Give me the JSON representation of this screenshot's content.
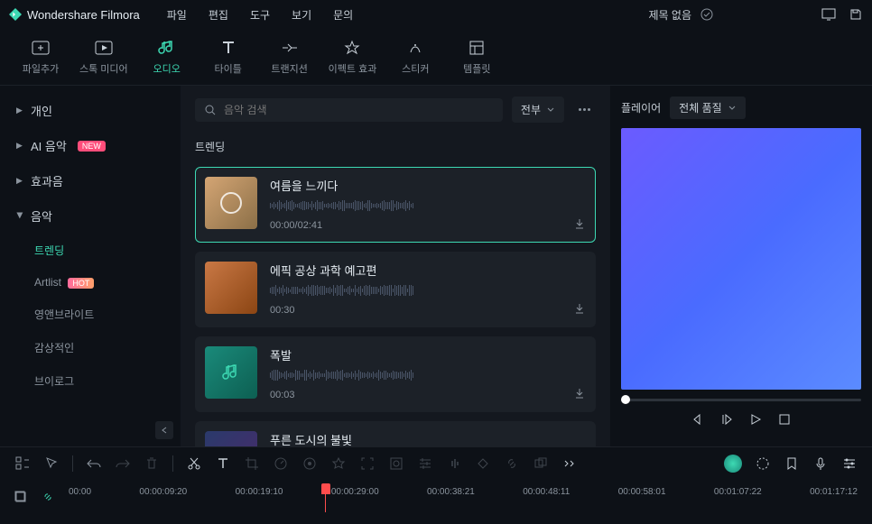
{
  "app": {
    "name": "Wondershare Filmora"
  },
  "menu": [
    "파일",
    "편집",
    "도구",
    "보기",
    "문의"
  ],
  "doc_title": "제목 없음",
  "tabs": [
    {
      "label": "파일추가"
    },
    {
      "label": "스톡 미디어"
    },
    {
      "label": "오디오"
    },
    {
      "label": "타이틀"
    },
    {
      "label": "트랜지션"
    },
    {
      "label": "이펙트 효과"
    },
    {
      "label": "스티커"
    },
    {
      "label": "템플릿"
    }
  ],
  "sidebar": {
    "items": [
      {
        "label": "개인"
      },
      {
        "label": "AI 음악",
        "badge": "NEW"
      },
      {
        "label": "효과음"
      },
      {
        "label": "음악"
      }
    ],
    "subs": [
      {
        "label": "트렌딩"
      },
      {
        "label": "Artlist",
        "badge": "HOT"
      },
      {
        "label": "영앤브라이트"
      },
      {
        "label": "감상적인"
      },
      {
        "label": "브이로그"
      }
    ]
  },
  "search": {
    "placeholder": "음악 검색"
  },
  "filter": {
    "label": "전부"
  },
  "section_title": "트렌딩",
  "tracks": [
    {
      "title": "여름을 느끼다",
      "time": "00:00/02:41"
    },
    {
      "title": "에픽 공상 과학 예고편",
      "time": "00:30"
    },
    {
      "title": "폭발",
      "time": "00:03"
    },
    {
      "title": "푸른 도시의 불빛",
      "time": ""
    }
  ],
  "preview": {
    "title": "플레이어",
    "quality": "전체 품질"
  },
  "timeline": {
    "marks": [
      "00:00",
      "00:00:09:20",
      "00:00:19:10",
      "00:00:29:00",
      "00:00:38:21",
      "00:00:48:11",
      "00:00:58:01",
      "00:01:07:22",
      "00:01:17:12"
    ]
  }
}
